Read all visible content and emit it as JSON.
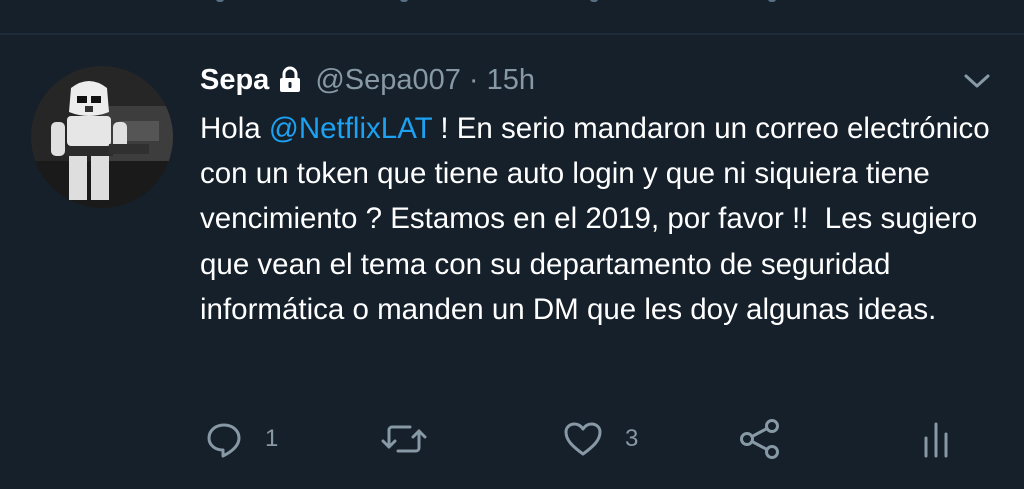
{
  "tweet": {
    "author_name": "Sepa",
    "author_handle": "@Sepa007",
    "separator": "·",
    "timestamp": "15h",
    "text_before_mention": "Hola ",
    "mention": "@NetflixLAT",
    "text_after_mention": " ! En serio mandaron un correo electrónico con un token que tiene auto login y que ni siquiera tiene vencimiento ? Estamos en el 2019, por favor !!  Les sugiero que vean el tema con su departamento de seguridad informática o manden un DM que les doy algunas ideas."
  },
  "actions": {
    "reply_count": "1",
    "like_count": "3"
  },
  "icons": {
    "lock": "lock-icon",
    "caret": "chevron-down-icon",
    "reply": "speech-bubble-icon",
    "retweet": "retweet-icon",
    "like": "heart-icon",
    "share": "share-icon",
    "analytics": "bar-chart-icon"
  },
  "colors": {
    "background": "#15202b",
    "text": "#ffffff",
    "secondary_text": "#8899a6",
    "link": "#1da1f2"
  }
}
